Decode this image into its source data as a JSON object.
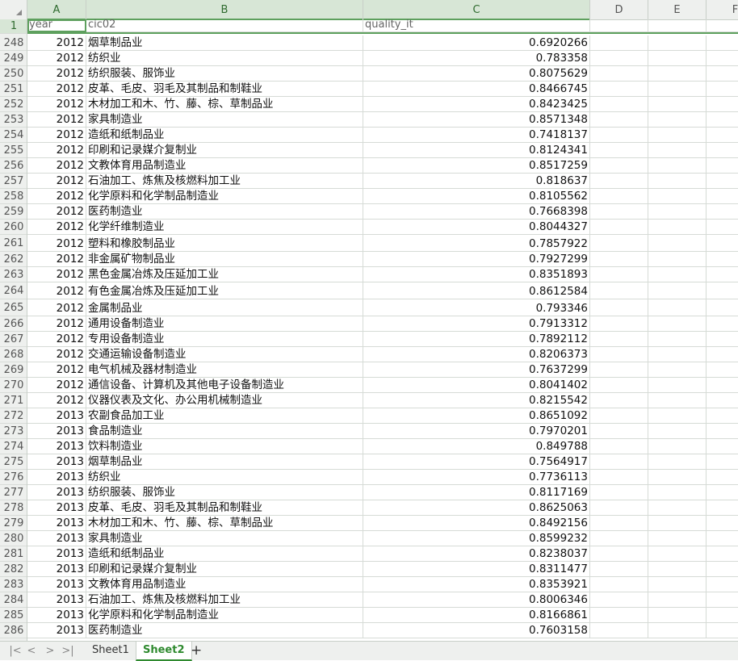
{
  "columns": [
    {
      "letter": "A"
    },
    {
      "letter": "B"
    },
    {
      "letter": "C"
    },
    {
      "letter": "D"
    },
    {
      "letter": "E"
    },
    {
      "letter": "F"
    }
  ],
  "header_row": {
    "row_number": "1",
    "year": "year",
    "cic02": "cic02",
    "quality_it": "quality_it"
  },
  "rows": [
    {
      "n": "248",
      "year": "2012",
      "cic02": "烟草制品业",
      "quality_it": "0.6920266"
    },
    {
      "n": "249",
      "year": "2012",
      "cic02": "纺织业",
      "quality_it": "0.783358"
    },
    {
      "n": "250",
      "year": "2012",
      "cic02": "纺织服装、服饰业",
      "quality_it": "0.8075629"
    },
    {
      "n": "251",
      "year": "2012",
      "cic02": "皮革、毛皮、羽毛及其制品和制鞋业",
      "quality_it": "0.8466745"
    },
    {
      "n": "252",
      "year": "2012",
      "cic02": "木材加工和木、竹、藤、棕、草制品业",
      "quality_it": "0.8423425"
    },
    {
      "n": "253",
      "year": "2012",
      "cic02": "家具制造业",
      "quality_it": "0.8571348"
    },
    {
      "n": "254",
      "year": "2012",
      "cic02": "造纸和纸制品业",
      "quality_it": "0.7418137"
    },
    {
      "n": "255",
      "year": "2012",
      "cic02": "印刷和记录媒介复制业",
      "quality_it": "0.8124341"
    },
    {
      "n": "256",
      "year": "2012",
      "cic02": "文教体育用品制造业",
      "quality_it": "0.8517259"
    },
    {
      "n": "257",
      "year": "2012",
      "cic02": "石油加工、炼焦及核燃料加工业",
      "quality_it": "0.818637"
    },
    {
      "n": "258",
      "year": "2012",
      "cic02": "化学原料和化学制品制造业",
      "quality_it": "0.8105562"
    },
    {
      "n": "259",
      "year": "2012",
      "cic02": "医药制造业",
      "quality_it": "0.7668398"
    },
    {
      "n": "260",
      "year": "2012",
      "cic02": "化学纤维制造业",
      "quality_it": "0.8044327"
    },
    {
      "n": "261",
      "year": "2012",
      "cic02": "塑料和橡胶制品业",
      "quality_it": "0.7857922"
    },
    {
      "n": "262",
      "year": "2012",
      "cic02": "非金属矿物制品业",
      "quality_it": "0.7927299"
    },
    {
      "n": "263",
      "year": "2012",
      "cic02": "黑色金属冶炼及压延加工业",
      "quality_it": "0.8351893"
    },
    {
      "n": "264",
      "year": "2012",
      "cic02": "有色金属冶炼及压延加工业",
      "quality_it": "0.8612584"
    },
    {
      "n": "265",
      "year": "2012",
      "cic02": "金属制品业",
      "quality_it": "0.793346"
    },
    {
      "n": "266",
      "year": "2012",
      "cic02": "通用设备制造业",
      "quality_it": "0.7913312"
    },
    {
      "n": "267",
      "year": "2012",
      "cic02": "专用设备制造业",
      "quality_it": "0.7892112"
    },
    {
      "n": "268",
      "year": "2012",
      "cic02": "交通运输设备制造业",
      "quality_it": "0.8206373"
    },
    {
      "n": "269",
      "year": "2012",
      "cic02": "电气机械及器材制造业",
      "quality_it": "0.7637299"
    },
    {
      "n": "270",
      "year": "2012",
      "cic02": "通信设备、计算机及其他电子设备制造业",
      "quality_it": "0.8041402"
    },
    {
      "n": "271",
      "year": "2012",
      "cic02": "仪器仪表及文化、办公用机械制造业",
      "quality_it": "0.8215542"
    },
    {
      "n": "272",
      "year": "2013",
      "cic02": "农副食品加工业",
      "quality_it": "0.8651092"
    },
    {
      "n": "273",
      "year": "2013",
      "cic02": "食品制造业",
      "quality_it": "0.7970201"
    },
    {
      "n": "274",
      "year": "2013",
      "cic02": "饮料制造业",
      "quality_it": "0.849788"
    },
    {
      "n": "275",
      "year": "2013",
      "cic02": "烟草制品业",
      "quality_it": "0.7564917"
    },
    {
      "n": "276",
      "year": "2013",
      "cic02": "纺织业",
      "quality_it": "0.7736113"
    },
    {
      "n": "277",
      "year": "2013",
      "cic02": "纺织服装、服饰业",
      "quality_it": "0.8117169"
    },
    {
      "n": "278",
      "year": "2013",
      "cic02": "皮革、毛皮、羽毛及其制品和制鞋业",
      "quality_it": "0.8625063"
    },
    {
      "n": "279",
      "year": "2013",
      "cic02": "木材加工和木、竹、藤、棕、草制品业",
      "quality_it": "0.8492156"
    },
    {
      "n": "280",
      "year": "2013",
      "cic02": "家具制造业",
      "quality_it": "0.8599232"
    },
    {
      "n": "281",
      "year": "2013",
      "cic02": "造纸和纸制品业",
      "quality_it": "0.8238037"
    },
    {
      "n": "282",
      "year": "2013",
      "cic02": "印刷和记录媒介复制业",
      "quality_it": "0.8311477"
    },
    {
      "n": "283",
      "year": "2013",
      "cic02": "文教体育用品制造业",
      "quality_it": "0.8353921"
    },
    {
      "n": "284",
      "year": "2013",
      "cic02": "石油加工、炼焦及核燃料加工业",
      "quality_it": "0.8006346"
    },
    {
      "n": "285",
      "year": "2013",
      "cic02": "化学原料和化学制品制造业",
      "quality_it": "0.8166861"
    },
    {
      "n": "286",
      "year": "2013",
      "cic02": "医药制造业",
      "quality_it": "0.7603158"
    }
  ],
  "sheet_tabs": [
    {
      "label": "Sheet1",
      "active": false
    },
    {
      "label": "Sheet2",
      "active": true
    }
  ],
  "nav": {
    "first": "|<",
    "prev": "<",
    "next": ">",
    "last": ">|",
    "add": "+"
  },
  "colors": {
    "accent": "#2f8a2f",
    "grid": "#d6dbd6",
    "header_bg": "#eef0ee"
  }
}
